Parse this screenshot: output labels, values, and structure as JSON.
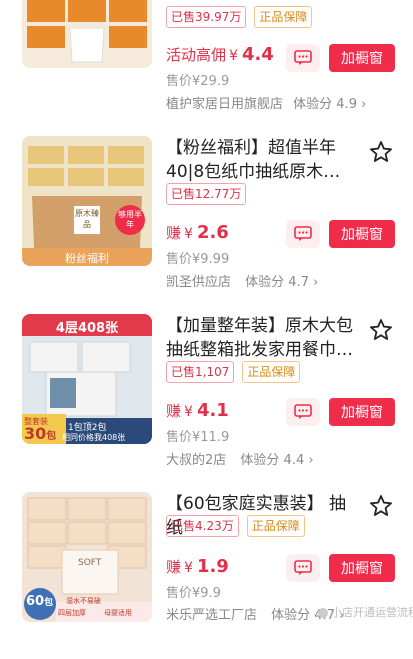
{
  "items": [
    {
      "sold_badge": "已售39.97万",
      "guarantee_badge": "正品保障",
      "price_prefix": "活动高佣",
      "yen": "¥",
      "price": "4.4",
      "sale_price": "售价¥29.9",
      "shop": "植护家居日用旗舰店",
      "experience": "体验分 4.9",
      "add_label": "加橱窗",
      "chat_icon": "chat-icon"
    },
    {
      "title": "【粉丝福利】超值半年40|8包纸巾抽纸原木抽纸家用...",
      "sold_badge": "已售12.77万",
      "price_prefix": "赚",
      "yen": "¥",
      "price": "2.6",
      "sale_price": "售价¥9.99",
      "shop": "凯圣供应店",
      "experience": "体验分 4.7",
      "add_label": "加橱窗",
      "thumb_label": "粉丝福利",
      "thumb_tag": "够用半年",
      "thumb_brand": "原木臻品"
    },
    {
      "title": "【加量整年装】原木大包抽纸整箱批发家用餐巾纸妇...",
      "sold_badge": "已售1,107",
      "guarantee_badge": "正品保障",
      "price_prefix": "赚",
      "yen": "¥",
      "price": "4.1",
      "sale_price": "售价¥11.9",
      "shop": "大叔的2店",
      "experience": "体验分 4.4",
      "add_label": "加橱窗",
      "thumb_top": "4层408张",
      "thumb_deal": "整套装",
      "thumb_30": "30",
      "thumb_bag": "包",
      "thumb_1for2": "1包顶2包",
      "thumb_compare": "相同价格我408张"
    },
    {
      "title": "【60包家庭实惠装】 抽纸",
      "sold_badge": "已售4.23万",
      "guarantee_badge": "正品保障",
      "price_prefix": "赚",
      "yen": "¥",
      "price": "1.9",
      "sale_price": "售价¥9.9",
      "shop": "米乐严选工厂店",
      "experience": "体验分 4.7",
      "add_label": "加橱窗",
      "thumb_60": "60",
      "thumb_bag": "包",
      "thumb_note1": "湿水不易破",
      "thumb_note2": "四层加厚",
      "thumb_note3": "母婴适用",
      "thumb_brand": "SOFT"
    }
  ],
  "watermark": "小店开通运营流程",
  "colors": {
    "accent": "#ef2d4a",
    "badge_red": "#e0304a",
    "badge_gold": "#d98a1a"
  }
}
